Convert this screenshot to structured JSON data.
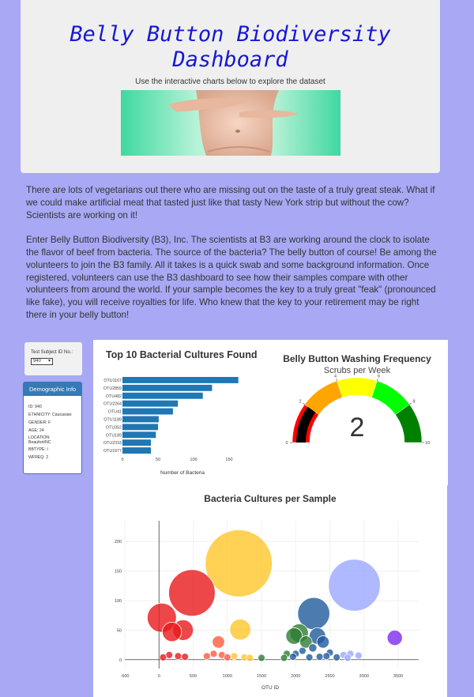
{
  "header": {
    "title": "Belly Button Biodiversity Dashboard",
    "subtitle": "Use the interactive charts below to explore the dataset"
  },
  "intro": {
    "p1": "There are lots of vegetarians out there who are missing out on the taste of a truly great steak. What if we could make artificial meat that tasted just like that tasty New York strip but without the cow? Scientists are working on it!",
    "p2": "Enter Belly Button Biodiversity (B3), Inc. The scientists at B3 are working around the clock to isolate the flavor of beef from bacteria. The source of the bacteria? The belly button of course! Be among the volunteers to join the B3 family. All it takes is a quick swab and some background information. Once registered, volunteers can use the B3 dashboard to see how their samples compare with other volunteers from around the world. If your sample becomes the key to a truly great \"feak\" (pronounced like fake), you will receive royalties for life. Who knew that the key to your retirement may be right there in your belly button!"
  },
  "selector": {
    "label": "Test Subject ID No.:",
    "value": "940"
  },
  "demographic": {
    "title": "Demographic Info",
    "rows": [
      "ID: 940",
      "ETHNICITY: Caucasian",
      "GENDER: F",
      "AGE: 24",
      "LOCATION: Beaufort/NC",
      "BBTYPE: I",
      "WFREQ: 2"
    ]
  },
  "colors": {
    "bar": "#1f77b4",
    "page_bg": "#a8a8f5",
    "panel_blue": "#337ab7",
    "title_blue": "#1717d6"
  },
  "chart_data": [
    {
      "type": "bar",
      "orientation": "horizontal",
      "title": "Top 10 Bacterial Cultures Found",
      "xlabel": "Number of Bacteria",
      "xlim": [
        0,
        170
      ],
      "xticks": [
        0,
        50,
        100,
        150
      ],
      "categories": [
        "OTU1167",
        "OTU2859",
        "OTU482",
        "OTU2264",
        "OTU41",
        "OTU1189",
        "OTU352",
        "OTU189",
        "OTU2318",
        "OTU1977"
      ],
      "values": [
        163,
        126,
        113,
        78,
        71,
        51,
        50,
        47,
        40,
        40
      ]
    },
    {
      "type": "gauge",
      "title": "Belly Button Washing Frequency",
      "subtitle": "Scrubs per Week",
      "value": 2,
      "range": [
        0,
        10
      ],
      "tick_labels": [
        "0",
        "2",
        "4",
        "6",
        "8",
        "10"
      ],
      "steps": [
        {
          "range": [
            0,
            2
          ],
          "color": "#ff0000"
        },
        {
          "range": [
            2,
            4
          ],
          "color": "#ffa500"
        },
        {
          "range": [
            4,
            6
          ],
          "color": "#ffff00"
        },
        {
          "range": [
            6,
            8
          ],
          "color": "#00ff00"
        },
        {
          "range": [
            8,
            10
          ],
          "color": "#008000"
        }
      ]
    },
    {
      "type": "scatter",
      "title": "Bacteria Cultures per Sample",
      "xlabel": "OTU ID",
      "ylabel": "",
      "xlim": [
        -500,
        3800
      ],
      "ylim": [
        -15,
        235
      ],
      "xticks": [
        -500,
        0,
        500,
        1000,
        1500,
        2000,
        2500,
        3000,
        3500
      ],
      "yticks": [
        0,
        50,
        100,
        150,
        200
      ],
      "grid": true,
      "points": [
        {
          "x": 1167,
          "y": 163,
          "c": "#ffc629"
        },
        {
          "x": 482,
          "y": 113,
          "c": "#e8191b"
        },
        {
          "x": 2859,
          "y": 126,
          "c": "#9aa8ff"
        },
        {
          "x": 2264,
          "y": 78,
          "c": "#1f5a9c"
        },
        {
          "x": 41,
          "y": 71,
          "c": "#e8191b"
        },
        {
          "x": 352,
          "y": 50,
          "c": "#e8191b"
        },
        {
          "x": 189,
          "y": 47,
          "c": "#e8191b"
        },
        {
          "x": 1189,
          "y": 51,
          "c": "#ffc629"
        },
        {
          "x": 2318,
          "y": 40,
          "c": "#1f5a9c"
        },
        {
          "x": 1977,
          "y": 40,
          "c": "#2e7d32"
        },
        {
          "x": 870,
          "y": 30,
          "c": "#ff5a3d"
        },
        {
          "x": 3450,
          "y": 37,
          "c": "#7b2cf0"
        },
        {
          "x": 2050,
          "y": 45,
          "c": "#2e7d32"
        },
        {
          "x": 2150,
          "y": 30,
          "c": "#2e7d32"
        },
        {
          "x": 2400,
          "y": 30,
          "c": "#1f5a9c"
        },
        {
          "x": 2250,
          "y": 20,
          "c": "#1f5a9c"
        },
        {
          "x": 2100,
          "y": 15,
          "c": "#1f5a9c"
        },
        {
          "x": 2500,
          "y": 12,
          "c": "#1f5a9c"
        },
        {
          "x": 2000,
          "y": 10,
          "c": "#1f5a9c"
        },
        {
          "x": 1870,
          "y": 10,
          "c": "#2e7d32"
        },
        {
          "x": 2700,
          "y": 8,
          "c": "#9aa8ff"
        },
        {
          "x": 2800,
          "y": 10,
          "c": "#9aa8ff"
        },
        {
          "x": 2920,
          "y": 7,
          "c": "#9aa8ff"
        },
        {
          "x": 800,
          "y": 10,
          "c": "#ff5a3d"
        },
        {
          "x": 920,
          "y": 8,
          "c": "#ff5a3d"
        },
        {
          "x": 700,
          "y": 6,
          "c": "#ff5a3d"
        },
        {
          "x": 1100,
          "y": 6,
          "c": "#ffc629"
        },
        {
          "x": 1250,
          "y": 4,
          "c": "#ffc629"
        },
        {
          "x": 1500,
          "y": 3,
          "c": "#2e7d32"
        },
        {
          "x": 150,
          "y": 8,
          "c": "#e8191b"
        },
        {
          "x": 280,
          "y": 6,
          "c": "#e8191b"
        },
        {
          "x": 380,
          "y": 5,
          "c": "#e8191b"
        },
        {
          "x": 60,
          "y": 4,
          "c": "#e8191b"
        },
        {
          "x": 1830,
          "y": 3,
          "c": "#2e7d32"
        },
        {
          "x": 2600,
          "y": 4,
          "c": "#1f5a9c"
        },
        {
          "x": 2350,
          "y": 5,
          "c": "#1f5a9c"
        },
        {
          "x": 2450,
          "y": 6,
          "c": "#1f5a9c"
        },
        {
          "x": 2200,
          "y": 4,
          "c": "#1f5a9c"
        },
        {
          "x": 1960,
          "y": 5,
          "c": "#1f5a9c"
        },
        {
          "x": 1330,
          "y": 3,
          "c": "#ffc629"
        },
        {
          "x": 1000,
          "y": 4,
          "c": "#ff5a3d"
        },
        {
          "x": 2760,
          "y": 3,
          "c": "#9aa8ff"
        }
      ]
    }
  ]
}
